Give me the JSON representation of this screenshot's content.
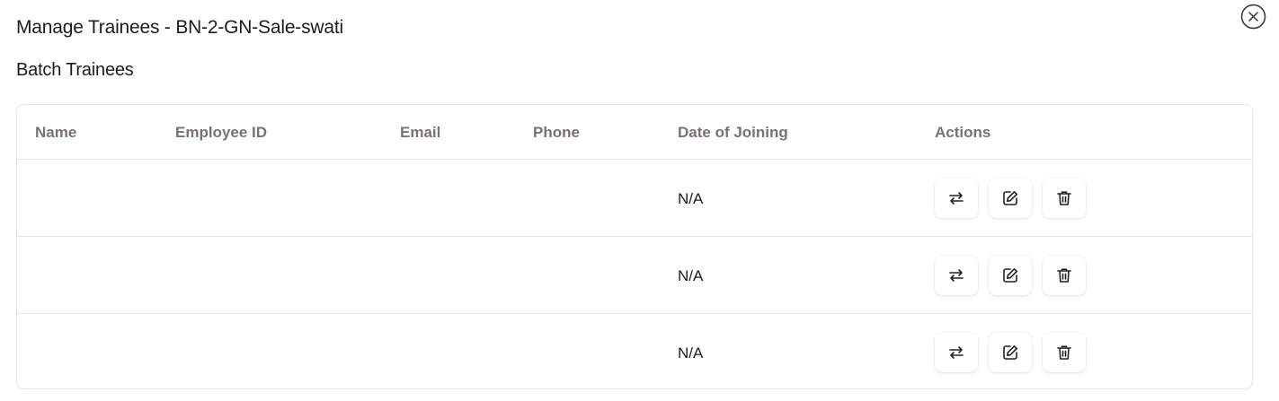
{
  "modal": {
    "title": "Manage Trainees - BN-2-GN-Sale-swati",
    "close_icon": "close-circle-icon"
  },
  "section": {
    "title": "Batch Trainees"
  },
  "table": {
    "columns": [
      "Name",
      "Employee ID",
      "Email",
      "Phone",
      "Date of Joining",
      "Actions"
    ],
    "rows": [
      {
        "name": "",
        "employee_id": "",
        "email": "",
        "phone": "",
        "date_of_joining": "N/A"
      },
      {
        "name": "",
        "employee_id": "",
        "email": "",
        "phone": "",
        "date_of_joining": "N/A"
      },
      {
        "name": "",
        "employee_id": "",
        "email": "",
        "phone": "",
        "date_of_joining": "N/A"
      }
    ],
    "action_icons": [
      "transfer-icon",
      "edit-icon",
      "delete-icon"
    ]
  }
}
